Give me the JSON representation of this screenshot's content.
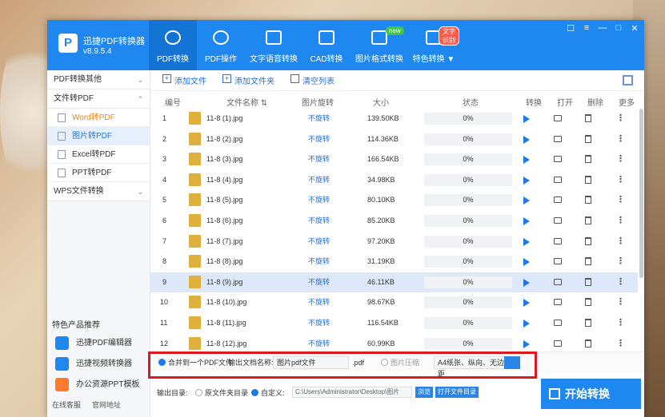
{
  "app": {
    "name": "迅捷PDF转换器",
    "version": "v8.9.5.4",
    "logo": "P"
  },
  "tabs": [
    {
      "label": "PDF转换",
      "icon": "convert-icon"
    },
    {
      "label": "PDF操作",
      "icon": "gear-icon"
    },
    {
      "label": "文字语音转换",
      "icon": "audio-wave-icon"
    },
    {
      "label": "CAD转换",
      "icon": "cad-download-icon"
    },
    {
      "label": "图片格式转换",
      "icon": "image-icon",
      "badge": "new"
    },
    {
      "label": "特色转换 ▼",
      "icon": "special-convert-icon",
      "badge": "文字识别"
    }
  ],
  "window_buttons": {
    "skin": "☐",
    "menu": "≡",
    "minimize": "—",
    "maximize": "□",
    "close": "✕"
  },
  "sidebar": {
    "groups": [
      {
        "label": "PDF转换其他",
        "chevron": "⌄"
      },
      {
        "label": "文件转PDF",
        "chevron": "⌃"
      },
      {
        "label": "WPS文件转换",
        "chevron": "⌄"
      }
    ],
    "items": [
      {
        "label": "Word转PDF"
      },
      {
        "label": "图片转PDF"
      },
      {
        "label": "Excel转PDF"
      },
      {
        "label": "PPT转PDF"
      }
    ],
    "featured_title": "特色产品推荐",
    "featured": [
      {
        "label": "迅捷PDF编辑器"
      },
      {
        "label": "迅捷视频转换器"
      },
      {
        "label": "办公资源PPT模板"
      }
    ],
    "footer": {
      "service": "在线客服",
      "website": "官网地址"
    }
  },
  "toolbar": {
    "add_file": "添加文件",
    "add_folder": "添加文件夹",
    "clear_list": "清空列表"
  },
  "table": {
    "headers": {
      "index": "编号",
      "name": "文件名称 ⇅",
      "rotate": "图片旋转",
      "size": "大小",
      "status": "状态",
      "convert": "转换",
      "open": "打开",
      "delete": "删除",
      "more": "更多"
    },
    "rows": [
      {
        "index": "1",
        "name": "11-8 (1).jpg",
        "rotate": "不旋转",
        "size": "139.50KB",
        "status": "0%"
      },
      {
        "index": "2",
        "name": "11-8 (2).jpg",
        "rotate": "不旋转",
        "size": "114.36KB",
        "status": "0%"
      },
      {
        "index": "3",
        "name": "11-8 (3).jpg",
        "rotate": "不旋转",
        "size": "166.54KB",
        "status": "0%"
      },
      {
        "index": "4",
        "name": "11-8 (4).jpg",
        "rotate": "不旋转",
        "size": "34.98KB",
        "status": "0%"
      },
      {
        "index": "5",
        "name": "11-8 (5).jpg",
        "rotate": "不旋转",
        "size": "80.10KB",
        "status": "0%"
      },
      {
        "index": "6",
        "name": "11-8 (6).jpg",
        "rotate": "不旋转",
        "size": "85.20KB",
        "status": "0%"
      },
      {
        "index": "7",
        "name": "11-8 (7).jpg",
        "rotate": "不旋转",
        "size": "97.20KB",
        "status": "0%"
      },
      {
        "index": "8",
        "name": "11-8 (8).jpg",
        "rotate": "不旋转",
        "size": "31.19KB",
        "status": "0%"
      },
      {
        "index": "9",
        "name": "11-8 (9).jpg",
        "rotate": "不旋转",
        "size": "46.11KB",
        "status": "0%"
      },
      {
        "index": "10",
        "name": "11-8 (10).jpg",
        "rotate": "不旋转",
        "size": "98.67KB",
        "status": "0%"
      },
      {
        "index": "11",
        "name": "11-8 (11).jpg",
        "rotate": "不旋转",
        "size": "116.54KB",
        "status": "0%"
      },
      {
        "index": "12",
        "name": "11-8 (12).jpg",
        "rotate": "不旋转",
        "size": "60.99KB",
        "status": "0%"
      }
    ],
    "more_symbol": "⋮"
  },
  "options": {
    "merge_label": "合并到一个PDF文件",
    "output_name_label": "输出文档名称:",
    "output_name_value": "图片pdf文件",
    "ext": ".pdf",
    "compress_label": "图片压缩",
    "page_setting": "A4纸张、纵向、无边距"
  },
  "bottom": {
    "output_dir_label": "输出目录:",
    "source_dir_label": "原文件夹目录",
    "custom_label": "自定义:",
    "path": "C:\\Users\\Administrator\\Desktop\\图片",
    "browse": "浏览",
    "open_dir": "打开文件目录",
    "start": "开始转换"
  },
  "colors": {
    "accent": "#1e88f0",
    "highlight_row": "#dde9fb",
    "annotation_red": "#e0181c"
  }
}
